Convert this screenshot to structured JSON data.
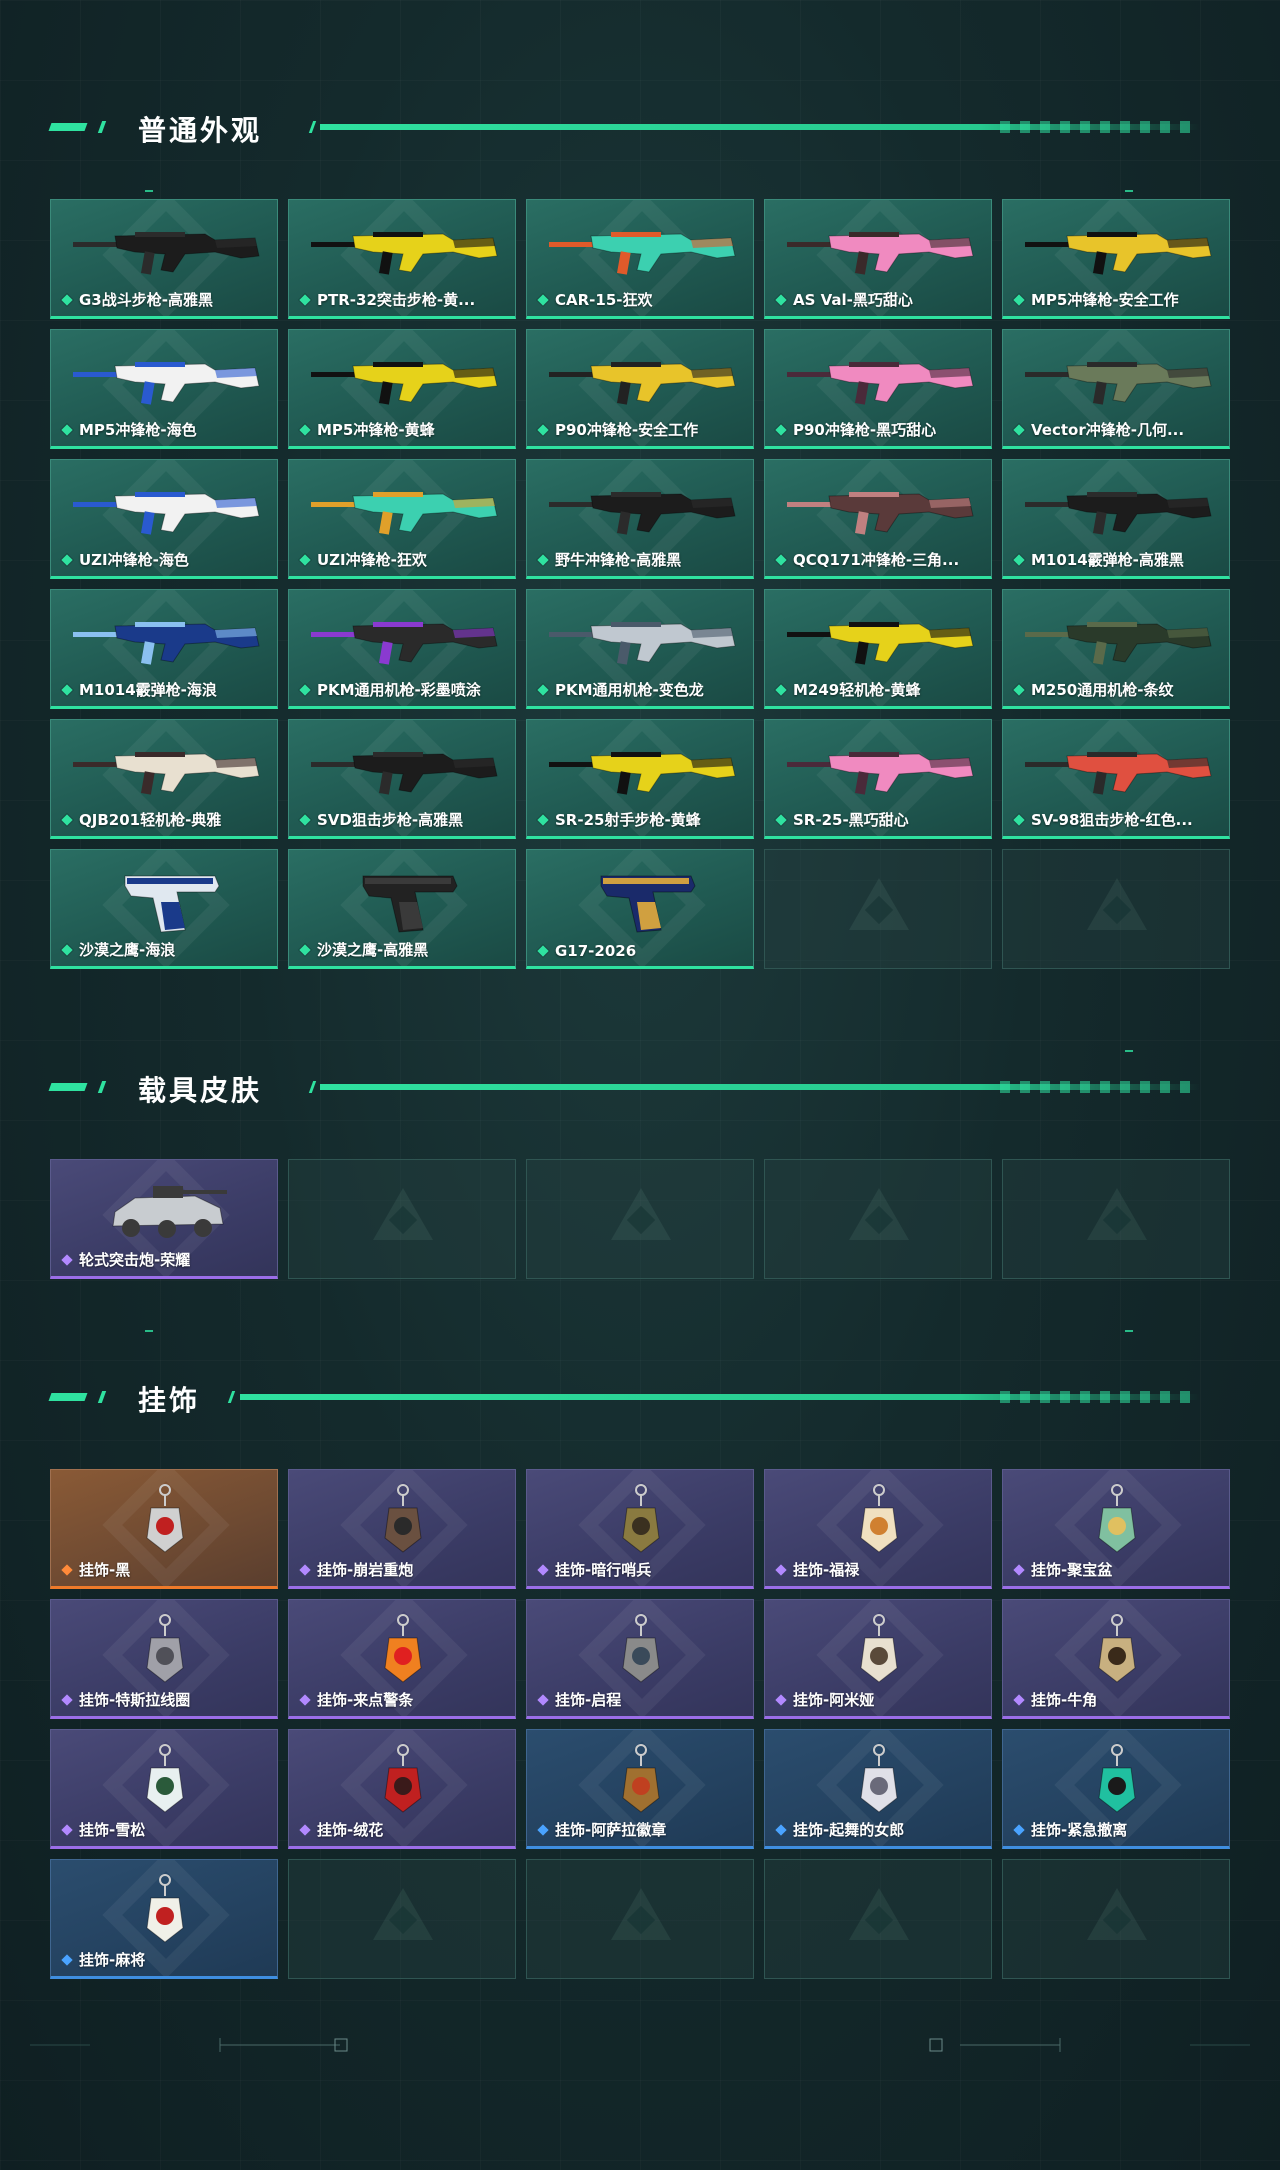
{
  "sections": {
    "weapons": {
      "title": "普通外观",
      "items": [
        {
          "label": "G3战斗步枪-高雅黑",
          "rarity": "green",
          "c1": "#1c1c1c",
          "c2": "#2b2b2b"
        },
        {
          "label": "PTR-32突击步枪-黄...",
          "rarity": "green",
          "c1": "#e6d21a",
          "c2": "#111111"
        },
        {
          "label": "CAR-15-狂欢",
          "rarity": "green",
          "c1": "#3cd0b0",
          "c2": "#e05a2a"
        },
        {
          "label": "AS Val-黑巧甜心",
          "rarity": "green",
          "c1": "#f08ac0",
          "c2": "#3a2a2a"
        },
        {
          "label": "MP5冲锋枪-安全工作",
          "rarity": "green",
          "c1": "#e8c42a",
          "c2": "#111111"
        },
        {
          "label": "MP5冲锋枪-海色",
          "rarity": "green",
          "c1": "#f2f2f2",
          "c2": "#2a5ad0"
        },
        {
          "label": "MP5冲锋枪-黄蜂",
          "rarity": "green",
          "c1": "#e6d21a",
          "c2": "#111111"
        },
        {
          "label": "P90冲锋枪-安全工作",
          "rarity": "green",
          "c1": "#e8c42a",
          "c2": "#222222"
        },
        {
          "label": "P90冲锋枪-黑巧甜心",
          "rarity": "green",
          "c1": "#f08ac0",
          "c2": "#4a2a3a"
        },
        {
          "label": "Vector冲锋枪-几何...",
          "rarity": "green",
          "c1": "#6a7a5a",
          "c2": "#2a2a2a"
        },
        {
          "label": "UZI冲锋枪-海色",
          "rarity": "green",
          "c1": "#f2f2f2",
          "c2": "#2a5ad0"
        },
        {
          "label": "UZI冲锋枪-狂欢",
          "rarity": "green",
          "c1": "#3cd0b0",
          "c2": "#e0a02a"
        },
        {
          "label": "野牛冲锋枪-高雅黑",
          "rarity": "green",
          "c1": "#1c1c1c",
          "c2": "#2b2b2b"
        },
        {
          "label": "QCQ171冲锋枪-三角...",
          "rarity": "green",
          "c1": "#5a3a3a",
          "c2": "#c08080"
        },
        {
          "label": "M1014霰弹枪-高雅黑",
          "rarity": "green",
          "c1": "#1c1c1c",
          "c2": "#2b2b2b"
        },
        {
          "label": "M1014霰弹枪-海浪",
          "rarity": "green",
          "c1": "#1a3a8a",
          "c2": "#8ac0f0"
        },
        {
          "label": "PKM通用机枪-彩墨喷涂",
          "rarity": "green",
          "c1": "#2a2a2a",
          "c2": "#8a3ad0"
        },
        {
          "label": "PKM通用机枪-变色龙",
          "rarity": "green",
          "c1": "#c0c8d0",
          "c2": "#4a5a6a"
        },
        {
          "label": "M249轻机枪-黄蜂",
          "rarity": "green",
          "c1": "#e6d21a",
          "c2": "#111111"
        },
        {
          "label": "M250通用机枪-条纹",
          "rarity": "green",
          "c1": "#2a3a2a",
          "c2": "#5a6a4a"
        },
        {
          "label": "QJB201轻机枪-典雅",
          "rarity": "green",
          "c1": "#e8e0d0",
          "c2": "#3a2a2a"
        },
        {
          "label": "SVD狙击步枪-高雅黑",
          "rarity": "green",
          "c1": "#1c1c1c",
          "c2": "#2b2b2b"
        },
        {
          "label": "SR-25射手步枪-黄蜂",
          "rarity": "green",
          "c1": "#e6d21a",
          "c2": "#111111"
        },
        {
          "label": "SR-25-黑巧甜心",
          "rarity": "green",
          "c1": "#f08ac0",
          "c2": "#4a2a3a"
        },
        {
          "label": "SV-98狙击步枪-红色...",
          "rarity": "green",
          "c1": "#e05040",
          "c2": "#2a2a2a"
        },
        {
          "label": "沙漠之鹰-海浪",
          "rarity": "green",
          "c1": "#e0e8f0",
          "c2": "#1a3a8a",
          "pistol": true
        },
        {
          "label": "沙漠之鹰-高雅黑",
          "rarity": "green",
          "c1": "#222222",
          "c2": "#3a3a3a",
          "pistol": true
        },
        {
          "label": "G17-2026",
          "rarity": "green",
          "c1": "#1a2a6a",
          "c2": "#d0a040",
          "pistol": true
        }
      ],
      "empty_slots": 2
    },
    "vehicles": {
      "title": "载具皮肤",
      "items": [
        {
          "label": "轮式突击炮-荣耀",
          "rarity": "purple",
          "c1": "#c8ccd0",
          "c2": "#3a3a3a"
        }
      ],
      "empty_slots": 4
    },
    "charms": {
      "title": "挂饰",
      "items": [
        {
          "label": "挂饰-黑",
          "rarity": "orange",
          "c1": "#d0d0d0",
          "c2": "#c02020"
        },
        {
          "label": "挂饰-崩岩重炮",
          "rarity": "purple",
          "c1": "#6a5040",
          "c2": "#2a2a2a"
        },
        {
          "label": "挂饰-暗行哨兵",
          "rarity": "purple",
          "c1": "#8a7a40",
          "c2": "#3a3020"
        },
        {
          "label": "挂饰-福禄",
          "rarity": "purple",
          "c1": "#f0e0c0",
          "c2": "#d08030"
        },
        {
          "label": "挂饰-聚宝盆",
          "rarity": "purple",
          "c1": "#80c0a0",
          "c2": "#e0c060"
        },
        {
          "label": "挂饰-特斯拉线圈",
          "rarity": "purple",
          "c1": "#a0a0a8",
          "c2": "#505058"
        },
        {
          "label": "挂饰-来点警条",
          "rarity": "purple",
          "c1": "#f08020",
          "c2": "#e02020"
        },
        {
          "label": "挂饰-启程",
          "rarity": "purple",
          "c1": "#8a8a8a",
          "c2": "#3a4a5a"
        },
        {
          "label": "挂饰-阿米娅",
          "rarity": "purple",
          "c1": "#e8e0d0",
          "c2": "#5a4a3a"
        },
        {
          "label": "挂饰-牛角",
          "rarity": "purple",
          "c1": "#c8b080",
          "c2": "#3a2a1a"
        },
        {
          "label": "挂饰-雪松",
          "rarity": "purple",
          "c1": "#e8f0f0",
          "c2": "#2a5a3a"
        },
        {
          "label": "挂饰-绒花",
          "rarity": "purple",
          "c1": "#c02020",
          "c2": "#3a1a1a"
        },
        {
          "label": "挂饰-阿萨拉徽章",
          "rarity": "blue",
          "c1": "#a07030",
          "c2": "#c04020"
        },
        {
          "label": "挂饰-起舞的女郎",
          "rarity": "blue",
          "c1": "#e0e0e8",
          "c2": "#6a6a7a"
        },
        {
          "label": "挂饰-紧急撤离",
          "rarity": "blue",
          "c1": "#20c0a0",
          "c2": "#1a1a1a"
        },
        {
          "label": "挂饰-麻将",
          "rarity": "blue",
          "c1": "#f0f0e8",
          "c2": "#c02020"
        }
      ],
      "empty_slots": 4
    }
  },
  "colors": {
    "accent": "#2fe2a0",
    "green_rarity": "#2fe2a0",
    "purple_rarity": "#9b6ee8",
    "blue_rarity": "#3f8ee0",
    "orange_rarity": "#ee7a2a"
  }
}
